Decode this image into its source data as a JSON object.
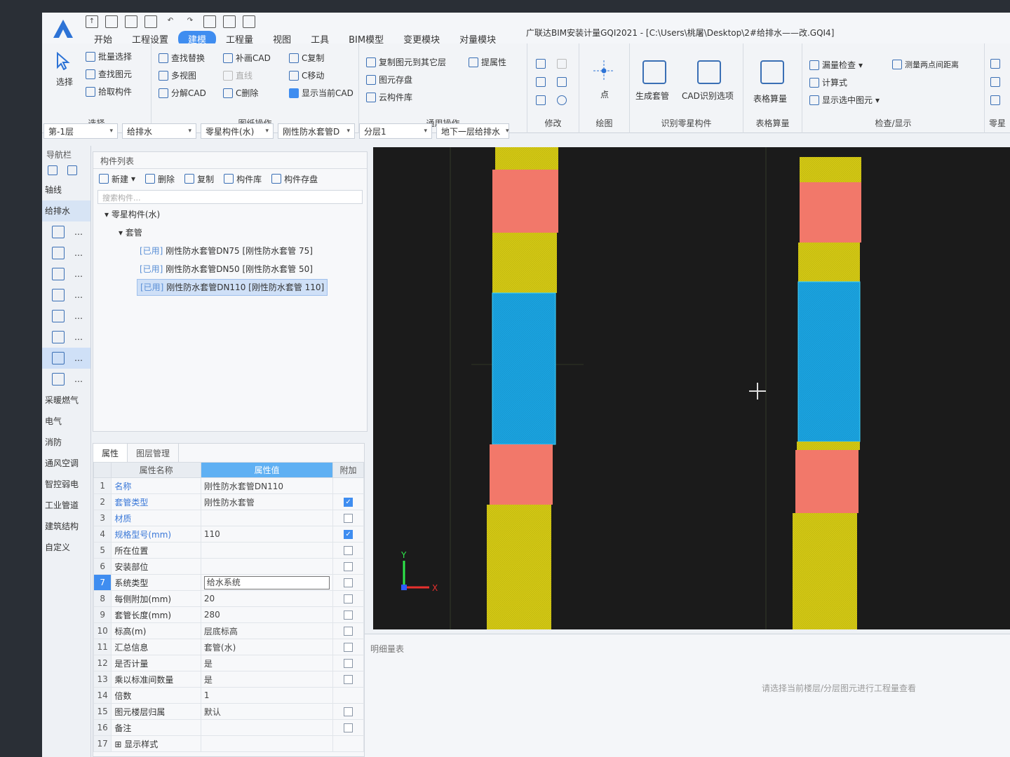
{
  "app": {
    "title": "广联达BIM安装计量GQI2021 - [C:\\Users\\桃屠\\Desktop\\2#给排水——改.GQI4]"
  },
  "menu": [
    "开始",
    "工程设置",
    "建模",
    "工程量",
    "视图",
    "工具",
    "BIM模型",
    "变更模块",
    "对量模块"
  ],
  "menu_active": "建模",
  "ribbon": {
    "select": {
      "big": "选择",
      "items": [
        "批量选择",
        "查找图元",
        "拾取构件"
      ],
      "label": "选择"
    },
    "drawing": {
      "items": [
        "查找替换",
        "补画CAD",
        "C复制",
        "多视图",
        "直线",
        "C移动",
        "分解CAD",
        "C删除",
        "显示当前CAD"
      ],
      "label": "图纸操作"
    },
    "common": {
      "items": [
        "复制图元到其它层",
        "提属性",
        "图元存盘",
        "云构件库"
      ],
      "label": "通用操作"
    },
    "modify": {
      "label": "修改"
    },
    "draw": {
      "big": "点",
      "label": "绘图"
    },
    "recognize": {
      "items": [
        "生成套管",
        "CAD识别选项"
      ],
      "label": "识别零星构件"
    },
    "table": {
      "big": "表格算量",
      "label": "表格算量"
    },
    "check": {
      "items": [
        "漏量检查",
        "测量两点间距离",
        "计算式",
        "显示选中图元"
      ],
      "label": "检查/显示"
    },
    "extra": {
      "label": "零星"
    }
  },
  "filters": [
    "第-1层",
    "给排水",
    "零星构件(水)",
    "刚性防水套管D",
    "分层1",
    "地下一层给排水"
  ],
  "nav": {
    "header": "导航栏",
    "items": [
      "轴线",
      "给排水",
      "采暖燃气",
      "电气",
      "消防",
      "通风空调",
      "智控弱电",
      "工业管道",
      "建筑结构",
      "自定义"
    ],
    "selected": "给排水"
  },
  "complist": {
    "title": "构件列表",
    "tools": [
      "新建",
      "删除",
      "复制",
      "构件库",
      "构件存盘"
    ],
    "search_placeholder": "搜索构件...",
    "root": "零星构件(水)",
    "group": "套管",
    "items": [
      {
        "tag": "[已用]",
        "name": "刚性防水套管DN75 [刚性防水套管 75]"
      },
      {
        "tag": "[已用]",
        "name": "刚性防水套管DN50 [刚性防水套管 50]"
      },
      {
        "tag": "[已用]",
        "name": "刚性防水套管DN110 [刚性防水套管 110]"
      }
    ]
  },
  "props": {
    "tabs": [
      "属性",
      "图层管理"
    ],
    "headers": [
      "属性名称",
      "属性值",
      "附加"
    ],
    "rows": [
      {
        "n": "1",
        "name": "名称",
        "val": "刚性防水套管DN110",
        "chk": null,
        "blue": true
      },
      {
        "n": "2",
        "name": "套管类型",
        "val": "刚性防水套管",
        "chk": true,
        "blue": true
      },
      {
        "n": "3",
        "name": "材质",
        "val": "",
        "chk": false,
        "blue": true
      },
      {
        "n": "4",
        "name": "规格型号(mm)",
        "val": "110",
        "chk": true,
        "blue": true
      },
      {
        "n": "5",
        "name": "所在位置",
        "val": "",
        "chk": false,
        "blue": false
      },
      {
        "n": "6",
        "name": "安装部位",
        "val": "",
        "chk": false,
        "blue": false
      },
      {
        "n": "7",
        "name": "系统类型",
        "val": "给水系统",
        "chk": false,
        "blue": false
      },
      {
        "n": "8",
        "name": "每侧附加(mm)",
        "val": "20",
        "chk": false,
        "blue": false
      },
      {
        "n": "9",
        "name": "套管长度(mm)",
        "val": "280",
        "chk": false,
        "blue": false
      },
      {
        "n": "10",
        "name": "标高(m)",
        "val": "层底标高",
        "chk": false,
        "blue": false
      },
      {
        "n": "11",
        "name": "汇总信息",
        "val": "套管(水)",
        "chk": false,
        "blue": false
      },
      {
        "n": "12",
        "name": "是否计量",
        "val": "是",
        "chk": false,
        "blue": false
      },
      {
        "n": "13",
        "name": "乘以标准间数量",
        "val": "是",
        "chk": false,
        "blue": false
      },
      {
        "n": "14",
        "name": "倍数",
        "val": "1",
        "chk": null,
        "blue": false
      },
      {
        "n": "15",
        "name": "图元楼层归属",
        "val": "默认",
        "chk": false,
        "blue": false
      },
      {
        "n": "16",
        "name": "备注",
        "val": "",
        "chk": false,
        "blue": false
      },
      {
        "n": "17",
        "name": "⊞ 显示样式",
        "val": "",
        "chk": null,
        "blue": false
      }
    ],
    "selected_row": "7"
  },
  "canvas": {
    "axis_x": "X",
    "axis_y": "Y",
    "colors": {
      "yellow": "#d4c914",
      "salmon": "#f2786a",
      "blue": "#1aa3e0",
      "bg": "#1b1b1b"
    }
  },
  "detail": {
    "title": "明细量表",
    "message": "请选择当前楼层/分层图元进行工程量查看"
  }
}
